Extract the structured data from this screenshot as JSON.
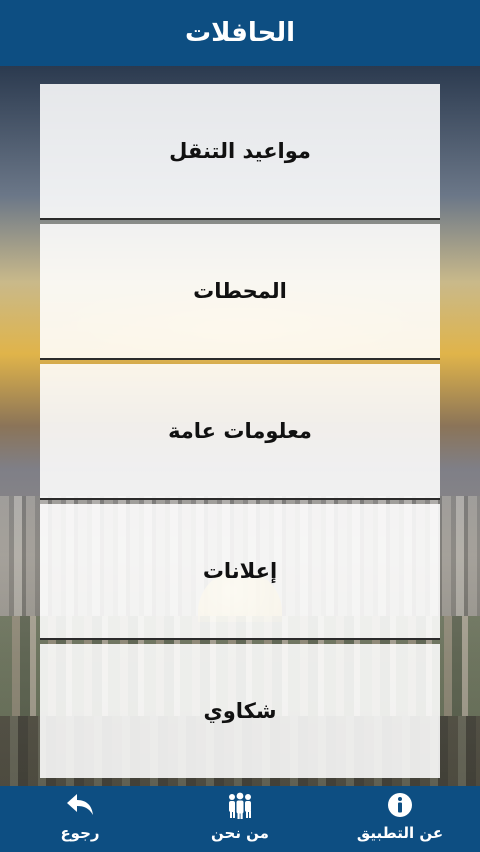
{
  "header": {
    "title": "الحافلات"
  },
  "menu": {
    "items": [
      {
        "label": "مواعيد التنقل"
      },
      {
        "label": "المحطات"
      },
      {
        "label": "معلومات عامة"
      },
      {
        "label": "إعلانات"
      },
      {
        "label": "شكاوي"
      }
    ]
  },
  "bottom_nav": {
    "back": {
      "label": "رجوع",
      "icon": "back-arrow-icon"
    },
    "about_us": {
      "label": "من نحن",
      "icon": "people-icon"
    },
    "about_app": {
      "label": "عن التطبيق",
      "icon": "info-icon"
    }
  },
  "colors": {
    "bar_blue": "#0d4e82",
    "card_white": "#ffffff"
  }
}
